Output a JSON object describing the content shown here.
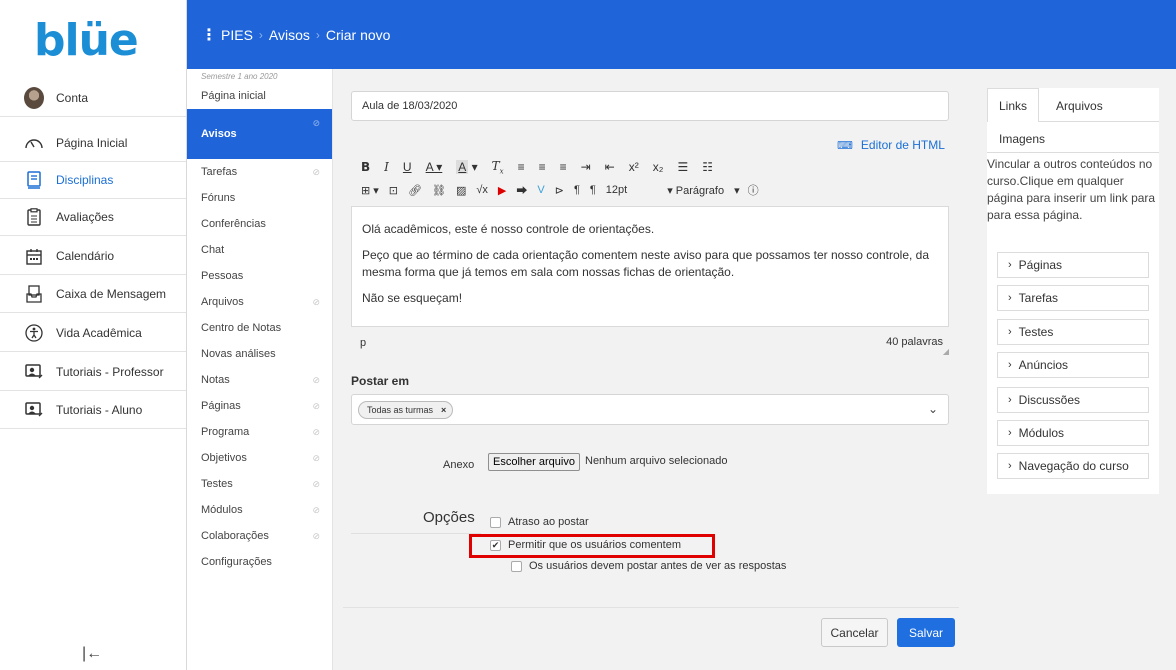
{
  "logo": {
    "text": "blüe"
  },
  "global_nav": {
    "items": [
      {
        "label": "Conta"
      },
      {
        "label": "Página Inicial"
      },
      {
        "label": "Disciplinas"
      },
      {
        "label": "Avaliações"
      },
      {
        "label": "Calendário"
      },
      {
        "label": "Caixa de Mensagem"
      },
      {
        "label": "Vida Acadêmica"
      },
      {
        "label": "Tutoriais - Professor"
      },
      {
        "label": "Tutoriais - Aluno"
      }
    ],
    "active": "Disciplinas",
    "collapse_glyph": "|←"
  },
  "topbar": {
    "menu_glyph": "⋮",
    "breadcrumb": [
      "PIES",
      "Avisos",
      "Criar novo"
    ],
    "color": "#1f64d8"
  },
  "course_nav": {
    "semester": "Semestre 1 ano 2020",
    "items": [
      {
        "label": "Página inicial"
      },
      {
        "label": "Avisos"
      },
      {
        "label": "Tarefas"
      },
      {
        "label": "Fóruns"
      },
      {
        "label": "Conferências"
      },
      {
        "label": "Chat"
      },
      {
        "label": "Pessoas"
      },
      {
        "label": "Arquivos"
      },
      {
        "label": "Centro de Notas"
      },
      {
        "label": "Novas análises"
      },
      {
        "label": "Notas"
      },
      {
        "label": "Páginas"
      },
      {
        "label": "Programa"
      },
      {
        "label": "Objetivos"
      },
      {
        "label": "Testes"
      },
      {
        "label": "Módulos"
      },
      {
        "label": "Colaborações"
      },
      {
        "label": "Configurações"
      }
    ],
    "active": "Avisos"
  },
  "editor": {
    "title_value": "Aula de 18/03/2020",
    "html_editor_label": "Editor de HTML",
    "font_size": "12pt",
    "format": "Parágrafo",
    "body": [
      "Olá acadêmicos, este é nosso controle de orientações.",
      "Peço que ao término de cada orientação comentem neste aviso para que possamos ter nosso controle, da mesma forma que já temos em sala com nossas fichas de orientação.",
      "Não se esqueçam!"
    ],
    "status_path": "p",
    "word_count": "40 palavras"
  },
  "postar": {
    "label": "Postar em",
    "chip": "Todas as turmas",
    "chip_remove": "×",
    "chevron": "⌄"
  },
  "anexo": {
    "label": "Anexo",
    "button": "Escolher arquivo",
    "status": "Nenhum arquivo selecionado"
  },
  "opcoes": {
    "label": "Opções",
    "options": [
      {
        "label": "Atraso ao postar",
        "checked": false
      },
      {
        "label": "Permitir que os usuários comentem",
        "checked": true
      },
      {
        "label": "Os usuários devem postar antes de ver as respostas",
        "checked": false
      }
    ],
    "check_glyph": "✔"
  },
  "actions": {
    "cancel": "Cancelar",
    "save": "Salvar"
  },
  "right_panel": {
    "tabs": [
      "Links",
      "Arquivos",
      "Imagens"
    ],
    "active_tab": "Links",
    "description": "Vincular a outros conteúdos no curso.Clique em qualquer página para inserir um link para para essa página.",
    "items": [
      "Páginas",
      "Tarefas",
      "Testes",
      "Anúncios",
      "Discussões",
      "Módulos",
      "Navegação do curso"
    ],
    "chevron": "›"
  }
}
